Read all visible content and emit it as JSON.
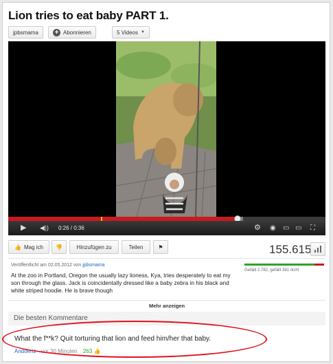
{
  "video": {
    "title": "Lion tries to eat baby PART 1.",
    "channel_label": "jpbsmama",
    "subscribe_label": "Abonnieren",
    "videos_label": "5 Videos",
    "time_display": "0:26 / 0:36",
    "progress_fraction": 0.722,
    "buffered_fraction": 0.74
  },
  "actions": {
    "like_label": "Mag ich",
    "add_to_label": "Hinzufügen zu",
    "share_label": "Teilen",
    "views": "155.615"
  },
  "details": {
    "published_prefix": "Veröffentlicht am 02.05.2012 von",
    "published_channel": "jpbsmama",
    "likes_text": "Gefällt 2.782, gefällt 381 nicht",
    "like_fraction": 0.88,
    "description": "At the zoo in Portland, Oregon the usually lazy lioness, Kya, tries desperately to eat my son through the glass. Jack is coincidentally dressed like a baby zebra in his black and white striped hoodie. He is brave though",
    "more_label": "Mehr anzeigen"
  },
  "comments": {
    "heading": "Die besten Kommentare",
    "top": {
      "text": "What the f**k? Quit torturing that lion and feed him/her that baby.",
      "author": "Andoeriz",
      "time": "vor 30 Minuten",
      "score": "263"
    }
  },
  "colors": {
    "accent_red": "#cc181e",
    "link_blue": "#1b65c5",
    "like_green": "#2ea12e",
    "annotation_red": "#e0121b"
  }
}
